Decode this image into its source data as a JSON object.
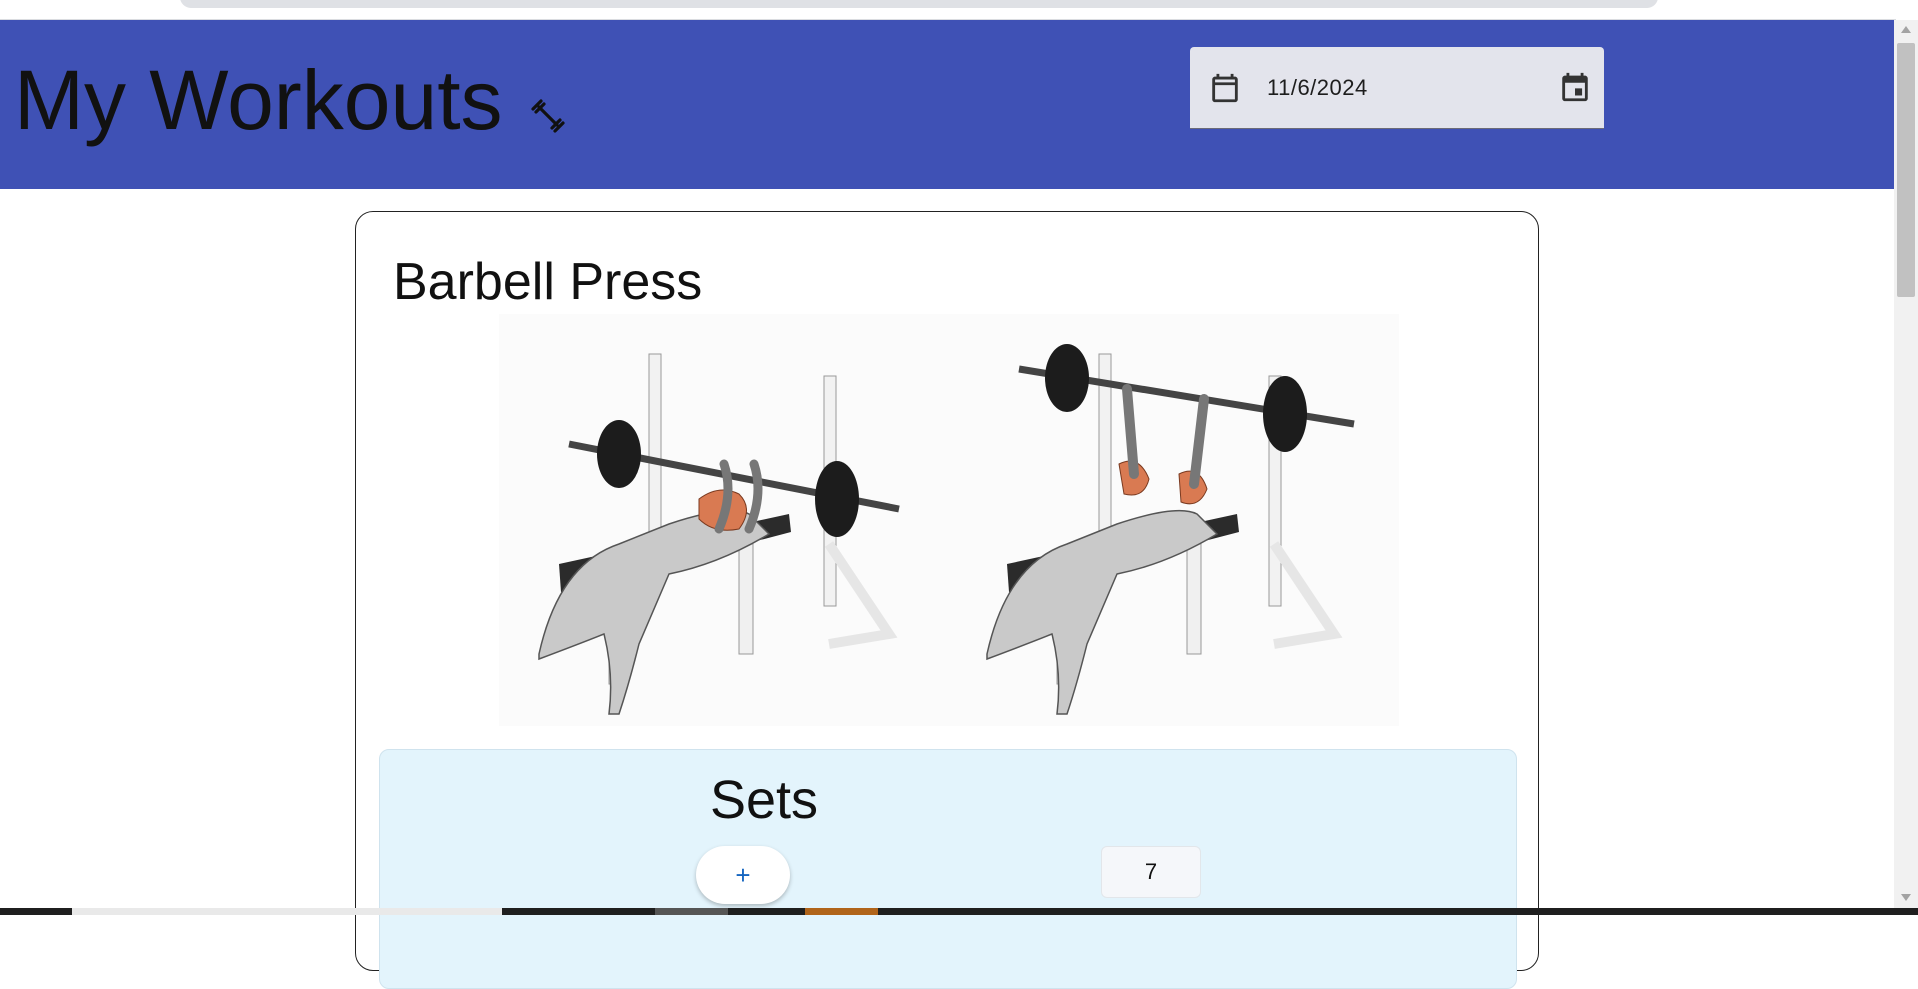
{
  "header": {
    "title": "My Workouts",
    "icon": "dumbbell-icon",
    "background": "#3f51b5",
    "date_picker": {
      "value": "11/6/2024",
      "left_icon": "calendar-icon",
      "right_icon": "calendar-picker-icon"
    }
  },
  "workout": {
    "exercise_name": "Barbell Press",
    "image": "barbell-bench-press-illustration",
    "sets": {
      "title": "Sets",
      "add_label": "+",
      "count": "7",
      "panel_color": "#e3f4fc"
    }
  }
}
